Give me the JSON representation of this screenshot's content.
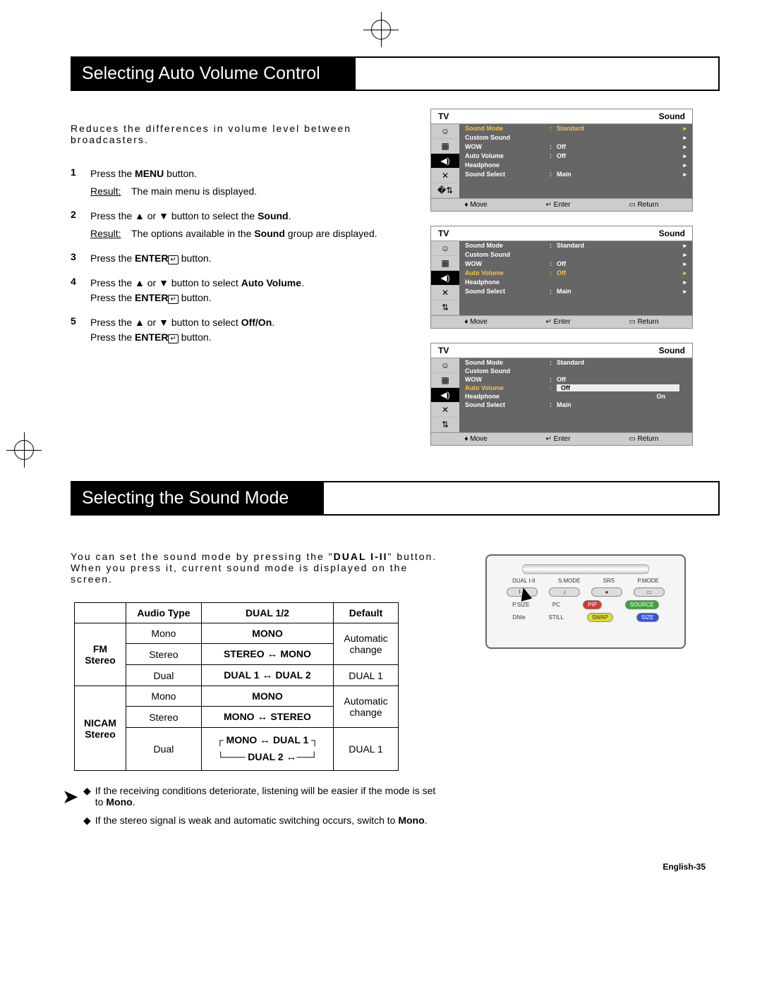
{
  "section1": {
    "title": "Selecting Auto Volume Control",
    "intro": "Reduces the differences in volume level between broadcasters.",
    "steps": [
      {
        "n": "1",
        "text_pre": "Press the ",
        "bold1": "MENU",
        "text_post": " button.",
        "result": "The main menu is displayed."
      },
      {
        "n": "2",
        "text_pre": "Press the ▲ or ▼ button to select the ",
        "bold1": "Sound",
        "text_post": ".",
        "result_pre": "The options available in the ",
        "result_bold": "Sound",
        "result_post": " group are displayed."
      },
      {
        "n": "3",
        "text_pre": "Press the ",
        "bold1": "ENTER",
        "text_post": " button."
      },
      {
        "n": "4",
        "text_pre": "Press the ▲ or ▼ button to select ",
        "bold1": "Auto Volume",
        "text_post": ".",
        "line2_pre": "Press the ",
        "line2_bold": "ENTER",
        "line2_post": " button."
      },
      {
        "n": "5",
        "text_pre": "Press the ▲ or ▼ button to select ",
        "bold1": "Off/On",
        "text_post": ".",
        "line2_pre": "Press the ",
        "line2_bold": "ENTER",
        "line2_post": " button."
      }
    ],
    "result_label": "Result:"
  },
  "osd": {
    "tv": "TV",
    "menu": "Sound",
    "rows": [
      {
        "name": "Sound Mode",
        "val": "Standard"
      },
      {
        "name": "Custom Sound",
        "val": ""
      },
      {
        "name": "WOW",
        "val": "Off"
      },
      {
        "name": "Auto Volume",
        "val": "Off"
      },
      {
        "name": "Headphone",
        "val": ""
      },
      {
        "name": "Sound Select",
        "val": "Main"
      }
    ],
    "foot": {
      "move": "Move",
      "enter": "Enter",
      "return": "Return"
    },
    "screen3_auto_val": "Off",
    "screen3_on": "On"
  },
  "section2": {
    "title": "Selecting the Sound Mode",
    "intro_l1": "You can set the sound mode by pressing the \"",
    "intro_bold": "DUAL I-II",
    "intro_l1b": "\" button.",
    "intro_l2": "When you press it, current sound mode is displayed on the screen.",
    "table": {
      "headers": [
        "",
        "Audio Type",
        "DUAL 1/2",
        "Default"
      ],
      "groups": [
        {
          "name": "FM\nStereo",
          "rows": [
            {
              "audio": "Mono",
              "dual": "MONO",
              "def": "Automatic\nchange",
              "defspan": 2
            },
            {
              "audio": "Stereo",
              "dual": "STEREO ↔ MONO"
            },
            {
              "audio": "Dual",
              "dual": "DUAL 1 ↔ DUAL 2",
              "def": "DUAL 1"
            }
          ]
        },
        {
          "name": "NICAM\nStereo",
          "rows": [
            {
              "audio": "Mono",
              "dual": "MONO",
              "def": "Automatic\nchange",
              "defspan": 2
            },
            {
              "audio": "Stereo",
              "dual": "MONO ↔ STEREO"
            },
            {
              "audio": "Dual",
              "dual": "MONO ↔ DUAL 1\nDUAL 2 ↔",
              "def": "DUAL 1"
            }
          ]
        }
      ]
    },
    "notes": [
      {
        "pre": "If the receiving conditions deteriorate, listening will be easier if the mode is set to ",
        "bold": "Mono",
        "post": "."
      },
      {
        "pre": "If the stereo signal is weak and automatic switching occurs, switch to ",
        "bold": "Mono",
        "post": "."
      }
    ]
  },
  "remote": {
    "row1": [
      "DUAL I-II",
      "S.MODE",
      "SRS",
      "P.MODE"
    ],
    "row2": [
      "P.SIZE",
      "PC",
      "PIP",
      "SOURCE"
    ],
    "row3": [
      "DNIe",
      "STILL",
      "SWAP",
      "SIZE"
    ]
  },
  "page_num": "English-35"
}
